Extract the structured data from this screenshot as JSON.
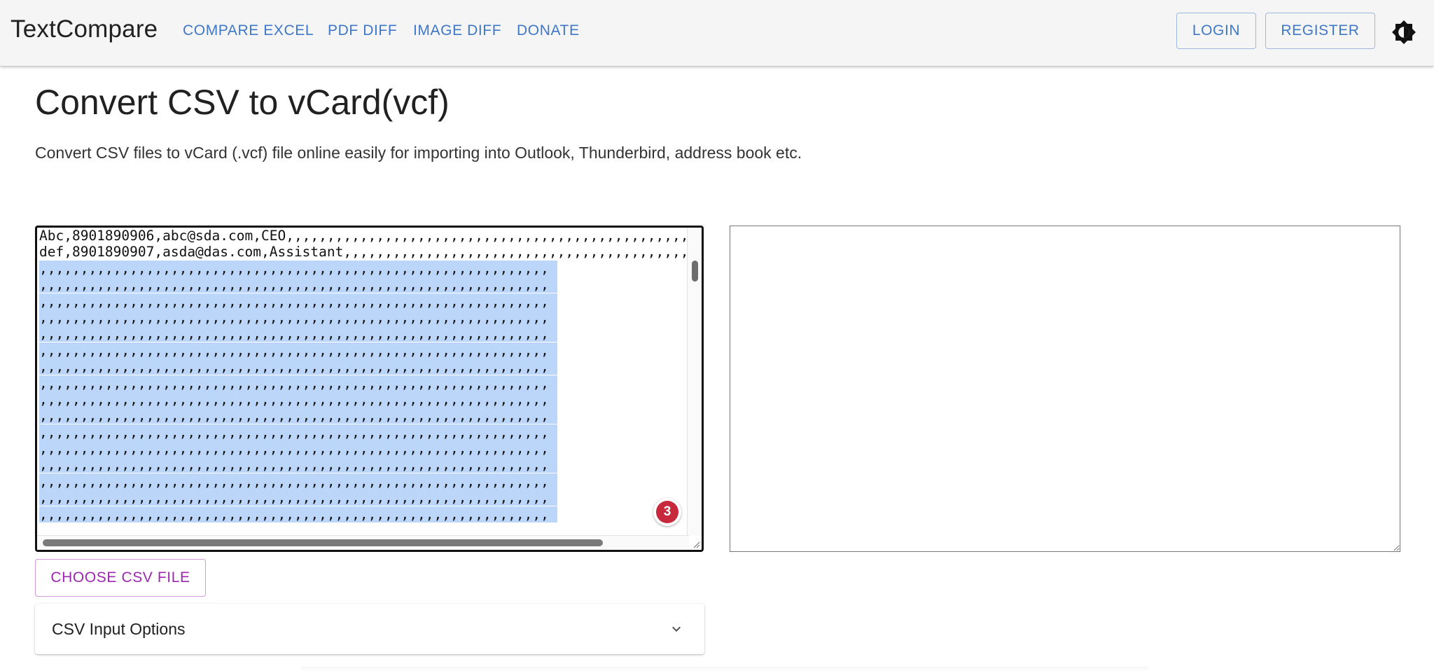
{
  "header": {
    "brand": "TextCompare",
    "nav": [
      "COMPARE EXCEL",
      "PDF DIFF",
      "IMAGE DIFF",
      "DONATE"
    ],
    "login": "LOGIN",
    "register": "REGISTER",
    "theme_icon": "brightness-icon"
  },
  "main": {
    "title": "Convert CSV to vCard(vcf)",
    "description": "Convert CSV files to vCard (.vcf) file online easily for importing into Outlook, Thunderbird, address book etc."
  },
  "input": {
    "lines": [
      "Abc,8901890906,abc@sda.com,CEO,,,,,,,,,,,,,,,,,,,,,,,,,,,,,,,,,,,,,,,,,,,,,,,,,,,,,,,,,,,,,,,,,",
      "def,8901890907,asda@das.com,Assistant,,,,,,,,,,,,,,,,,,,,,,,,,,,,,,,,,,,,,,,,,,,,,,,,,,,,,,,,,,,,,",
      ",,,,,,,,,,,,,,,,,,,,,,,,,,,,,,,,,,,,,,,,,,,,,,,,,,,,,,,,,,,,,,",
      ",,,,,,,,,,,,,,,,,,,,,,,,,,,,,,,,,,,,,,,,,,,,,,,,,,,,,,,,,,,,,,",
      ",,,,,,,,,,,,,,,,,,,,,,,,,,,,,,,,,,,,,,,,,,,,,,,,,,,,,,,,,,,,,,",
      ",,,,,,,,,,,,,,,,,,,,,,,,,,,,,,,,,,,,,,,,,,,,,,,,,,,,,,,,,,,,,,",
      ",,,,,,,,,,,,,,,,,,,,,,,,,,,,,,,,,,,,,,,,,,,,,,,,,,,,,,,,,,,,,,",
      ",,,,,,,,,,,,,,,,,,,,,,,,,,,,,,,,,,,,,,,,,,,,,,,,,,,,,,,,,,,,,,",
      ",,,,,,,,,,,,,,,,,,,,,,,,,,,,,,,,,,,,,,,,,,,,,,,,,,,,,,,,,,,,,,",
      ",,,,,,,,,,,,,,,,,,,,,,,,,,,,,,,,,,,,,,,,,,,,,,,,,,,,,,,,,,,,,,",
      ",,,,,,,,,,,,,,,,,,,,,,,,,,,,,,,,,,,,,,,,,,,,,,,,,,,,,,,,,,,,,,",
      ",,,,,,,,,,,,,,,,,,,,,,,,,,,,,,,,,,,,,,,,,,,,,,,,,,,,,,,,,,,,,,",
      ",,,,,,,,,,,,,,,,,,,,,,,,,,,,,,,,,,,,,,,,,,,,,,,,,,,,,,,,,,,,,,",
      ",,,,,,,,,,,,,,,,,,,,,,,,,,,,,,,,,,,,,,,,,,,,,,,,,,,,,,,,,,,,,,",
      ",,,,,,,,,,,,,,,,,,,,,,,,,,,,,,,,,,,,,,,,,,,,,,,,,,,,,,,,,,,,,,",
      ",,,,,,,,,,,,,,,,,,,,,,,,,,,,,,,,,,,,,,,,,,,,,,,,,,,,,,,,,,,,,,",
      ",,,,,,,,,,,,,,,,,,,,,,,,,,,,,,,,,,,,,,,,,,,,,,,,,,,,,,,,,,,,,,",
      ",,,,,,,,,,,,,,,,,,,,,,,,,,,,,,,,,,,,,,,,,,,,,,,,,,,,,,,,,,,,,,"
    ],
    "selected_from_line": 2,
    "badge_count": "3"
  },
  "output": {
    "value": ""
  },
  "actions": {
    "choose_file": "CHOOSE CSV FILE"
  },
  "options": {
    "title": "CSV Input Options",
    "expand_icon": "chevron-down-icon"
  },
  "colors": {
    "link": "#3f78c6",
    "accent": "#9c27b0",
    "selection": "#bcd6fa",
    "badge": "#c8283c"
  }
}
